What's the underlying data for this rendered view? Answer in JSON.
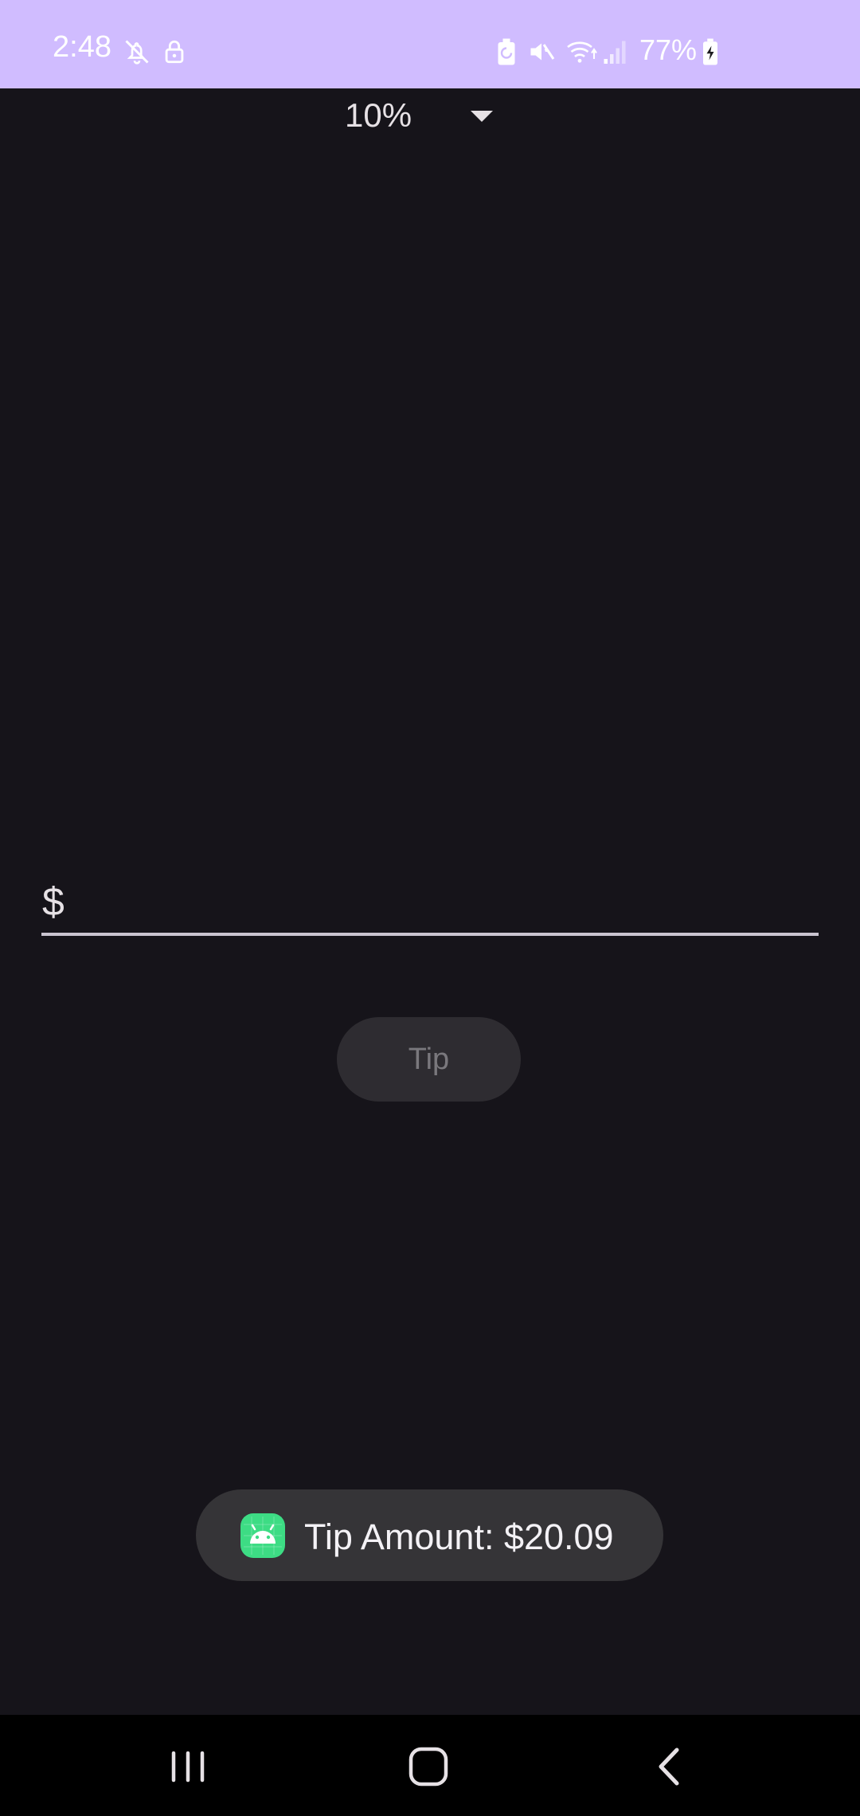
{
  "status_bar": {
    "time": "2:48",
    "battery_percent": "77%",
    "icons": [
      "notifications-off-icon",
      "lock-icon",
      "battery-saver-icon",
      "mute-icon",
      "wifi-icon",
      "signal-icon",
      "battery-charging-icon"
    ]
  },
  "spinner": {
    "selected": "10%"
  },
  "amount": {
    "prefix": "$",
    "value": "",
    "placeholder": ""
  },
  "tip_button": {
    "label": "Tip",
    "enabled": false
  },
  "toast": {
    "message": "Tip Amount: $20.09"
  },
  "nav_bar": {
    "buttons": [
      "recent-apps",
      "home",
      "back"
    ]
  },
  "colors": {
    "status_bar_bg": "#d0bcff",
    "background": "#16141a",
    "text_primary": "#e6e1e5",
    "button_disabled_bg": "#2e2c31",
    "button_disabled_text": "#7a787d",
    "toast_bg": "#353437",
    "nav_bar_bg": "#000000"
  }
}
